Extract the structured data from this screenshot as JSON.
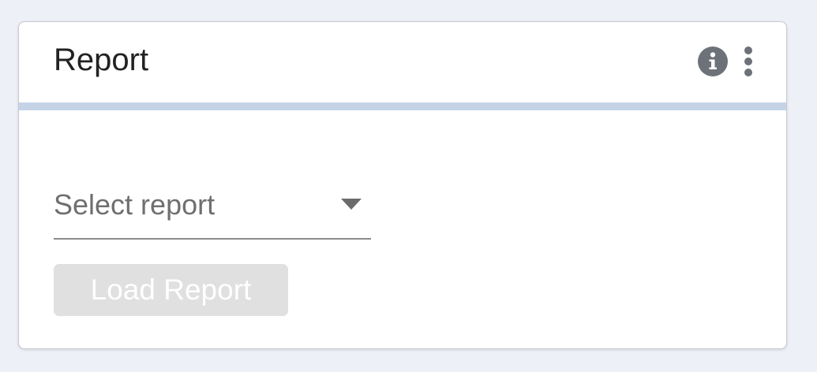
{
  "card": {
    "title": "Report"
  },
  "header_actions": {
    "info_icon": "info-circle",
    "more_icon": "vertical-ellipsis"
  },
  "report_select": {
    "placeholder": "Select report",
    "value": ""
  },
  "load_button": {
    "label": "Load Report",
    "disabled": true
  },
  "colors": {
    "page_background": "#eef0f8",
    "card_background": "#ffffff",
    "divider": "#c4d3e6",
    "icon": "#6d7178",
    "disabled_button": "#e0e0e0"
  }
}
